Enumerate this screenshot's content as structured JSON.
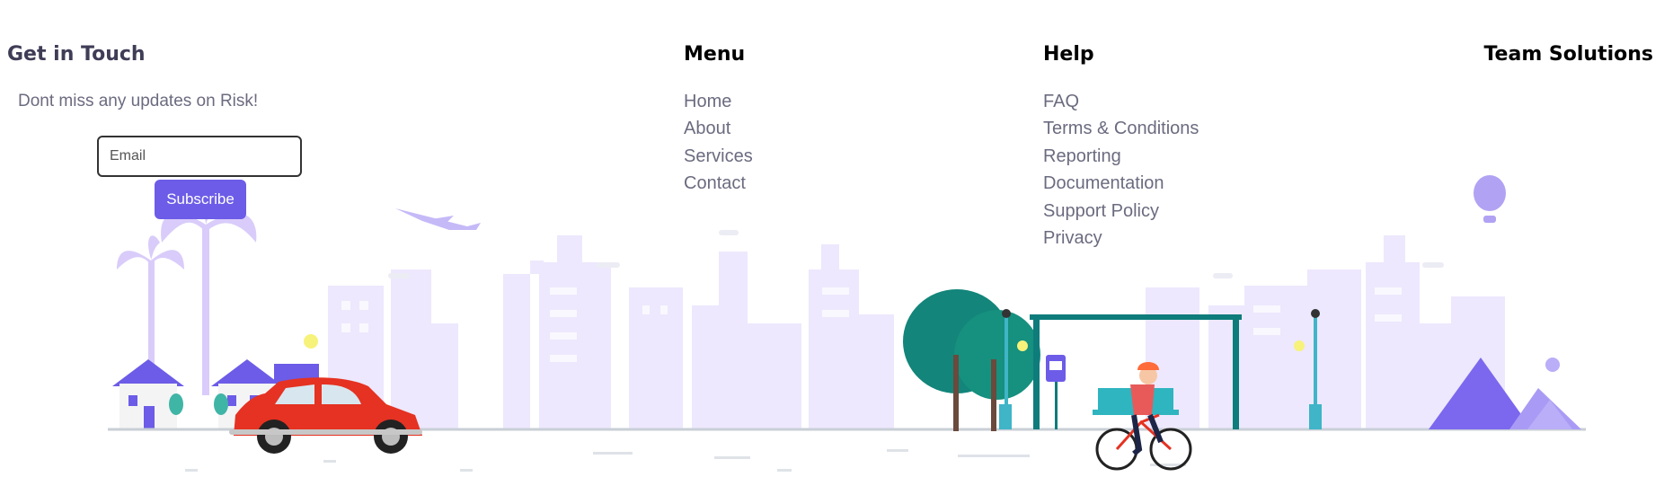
{
  "footer": {
    "get_in_touch": {
      "heading": "Get in Touch",
      "tagline": "Dont miss any updates on Risk!",
      "email_placeholder": "Email",
      "subscribe_label": "Subscribe"
    },
    "menu": {
      "heading": "Menu",
      "items": [
        "Home",
        "About",
        "Services",
        "Contact"
      ]
    },
    "help": {
      "heading": "Help",
      "items": [
        "FAQ",
        "Terms & Conditions",
        "Reporting",
        "Documentation",
        "Support Policy",
        "Privacy"
      ]
    },
    "team": {
      "heading": "Team Solutions"
    }
  },
  "colors": {
    "accent": "#6c5ce7",
    "heading_dark": "#3f3d56",
    "link_gray": "#6b6b80",
    "city_lavender": "#ede8fd",
    "car_red": "#e53222",
    "bus_stop_teal": "#0e7c7b"
  },
  "illustration_icons": [
    "palm-tree-icon",
    "airplane-icon",
    "house-icon",
    "car-icon",
    "tree-icon",
    "street-lamp-icon",
    "bus-stop-icon",
    "cyclist-icon",
    "hot-air-balloon-icon",
    "pyramid-icon",
    "sun-icon"
  ]
}
